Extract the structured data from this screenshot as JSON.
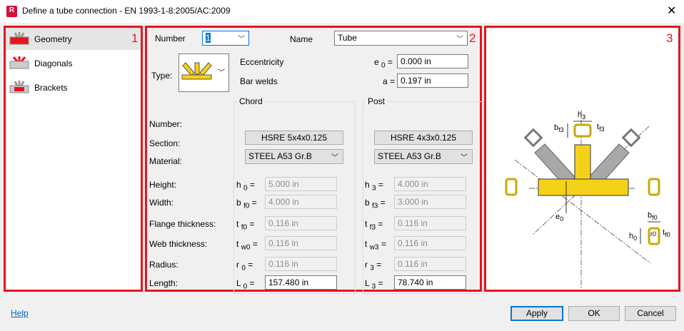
{
  "window": {
    "title": "Define a tube connection - EN 1993-1-8:2005/AC:2009",
    "app_icon_letter": "R",
    "close": "✕"
  },
  "panel_numbers": [
    "1",
    "2",
    "3"
  ],
  "sidebar": {
    "items": [
      {
        "label": "Geometry",
        "selected": true
      },
      {
        "label": "Diagonals",
        "selected": false
      },
      {
        "label": "Brackets",
        "selected": false
      }
    ]
  },
  "form": {
    "number_label": "Number",
    "number_value": "1",
    "name_label": "Name",
    "name_value": "Tube",
    "type_label": "Type:",
    "eccentricity_label": "Eccentricity",
    "e0_symbol": "e",
    "e0_sub": "0",
    "e0_value": "0.000 in",
    "bar_welds_label": "Bar welds",
    "a_symbol": "a",
    "a_value": "0.197 in",
    "chord_title": "Chord",
    "post_title": "Post",
    "row_labels": [
      "Number:",
      "Section:",
      "Material:",
      "Height:",
      "Width:",
      "Flange thickness:",
      "Web thickness:",
      "Radius:",
      "Length:"
    ],
    "chord": {
      "section": "HSRE 5x4x0.125",
      "material": "STEEL A53 Gr.B",
      "params": [
        {
          "sym": "h",
          "sub": "0",
          "value": "5.000 in",
          "enabled": false
        },
        {
          "sym": "b",
          "sub": "f0",
          "value": "4.000 in",
          "enabled": false
        },
        {
          "sym": "t",
          "sub": "f0",
          "value": "0.116 in",
          "enabled": false
        },
        {
          "sym": "t",
          "sub": "w0",
          "value": "0.116 in",
          "enabled": false
        },
        {
          "sym": "r",
          "sub": "0",
          "value": "0.116 in",
          "enabled": false
        },
        {
          "sym": "L",
          "sub": "0",
          "value": "157.480 in",
          "enabled": true
        }
      ]
    },
    "post": {
      "section": "HSRE 4x3x0.125",
      "material": "STEEL A53 Gr.B",
      "params": [
        {
          "sym": "h",
          "sub": "3",
          "value": "4.000 in",
          "enabled": false
        },
        {
          "sym": "b",
          "sub": "f3",
          "value": "3.000 in",
          "enabled": false
        },
        {
          "sym": "t",
          "sub": "f3",
          "value": "0.116 in",
          "enabled": false
        },
        {
          "sym": "t",
          "sub": "w3",
          "value": "0.116 in",
          "enabled": false
        },
        {
          "sym": "r",
          "sub": "3",
          "value": "0.116 in",
          "enabled": false
        },
        {
          "sym": "L",
          "sub": "3",
          "value": "78.740 in",
          "enabled": true
        }
      ]
    }
  },
  "diagram": {
    "labels": {
      "h3": "h",
      "h3s": "3",
      "bf3": "b",
      "bf3s": "f3",
      "tf3": "t",
      "tf3s": "f3",
      "e0": "e",
      "e0s": "0",
      "bf0": "b",
      "bf0s": "f0",
      "h0": "h",
      "h0s": "0",
      "tf0": "t",
      "tf0s": "f0",
      "r0": "r",
      "r0s": "0"
    }
  },
  "footer": {
    "help": "Help",
    "apply": "Apply",
    "ok": "OK",
    "cancel": "Cancel"
  },
  "colors": {
    "highlight": "#e8141c",
    "member": "#f5d21a",
    "diagonal": "#a8a8a8",
    "accent": "#0078d7"
  }
}
